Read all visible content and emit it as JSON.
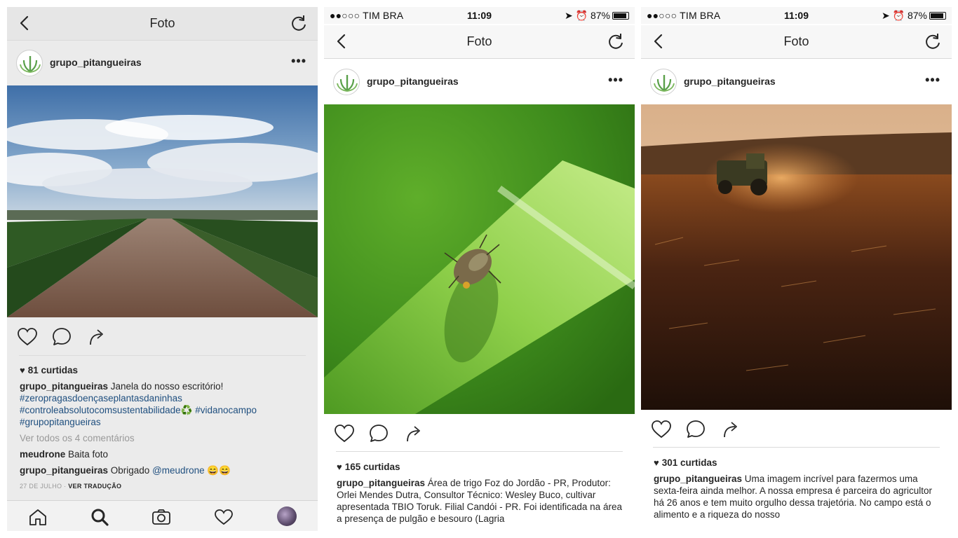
{
  "panels": [
    {
      "nav": {
        "title": "Foto"
      },
      "post": {
        "username": "grupo_pitangueiras",
        "likes": "81 curtidas",
        "caption_user": "grupo_pitangueiras",
        "caption_text": "Janela do nosso escritório!",
        "hashtags": [
          "#zeropragasdoençaseplantasdaninhas",
          "#controleabsolutocomsustentabilidade♻️",
          "#vidanocampo",
          "#grupopitangueiras"
        ],
        "view_comments": "Ver todos os 4 comentários",
        "comments": [
          {
            "user": "meudrone",
            "text": "Baita foto"
          },
          {
            "user": "grupo_pitangueiras",
            "text": "Obrigado",
            "mention": "@meudrone",
            "emoji": "😄😄"
          }
        ],
        "date": "27 DE JULHO",
        "translate": "VER TRADUÇÃO"
      }
    },
    {
      "status": {
        "carrier": "●●○○○ TIM BRA",
        "time": "11:09",
        "battery": "87%"
      },
      "nav": {
        "title": "Foto"
      },
      "post": {
        "username": "grupo_pitangueiras",
        "likes": "165 curtidas",
        "caption_user": "grupo_pitangueiras",
        "caption_text": "Área de trigo Foz do Jordão - PR, Produtor: Orlei Mendes Dutra, Consultor Técnico: Wesley Buco, cultivar apresentada TBIO Toruk. Filial Candói - PR. Foi identificada na área a presença de pulgão e besouro (Lagria"
      }
    },
    {
      "status": {
        "carrier": "●●○○○ TIM BRA",
        "time": "11:09",
        "battery": "87%"
      },
      "nav": {
        "title": "Foto"
      },
      "post": {
        "username": "grupo_pitangueiras",
        "likes": "301 curtidas",
        "caption_user": "grupo_pitangueiras",
        "caption_text": "Uma imagem incrível para fazermos uma sexta-feira ainda melhor. A nossa empresa é parceira do agricultor há 26 anos e tem muito orgulho dessa trajetória. No campo está o alimento e a riqueza do nosso"
      }
    }
  ],
  "icons": [
    "back-icon",
    "reload-icon",
    "more-icon",
    "heart-icon",
    "comment-icon",
    "share-icon",
    "home-icon",
    "search-icon",
    "camera-icon",
    "activity-icon",
    "profile-avatar"
  ],
  "colors": {
    "hashtag": "#1f4f7f",
    "muted": "#999999",
    "logo_green": "#5aa04a"
  }
}
